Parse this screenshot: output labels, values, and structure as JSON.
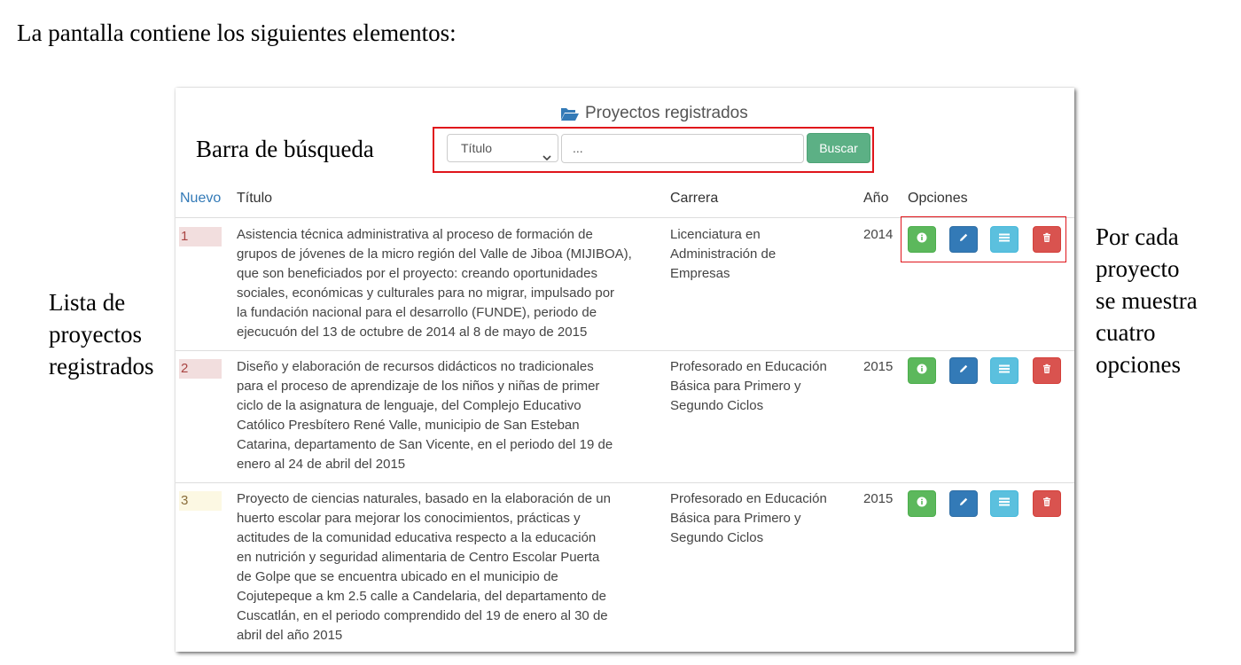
{
  "intro_text": "La pantalla contiene los siguientes elementos:",
  "panel": {
    "title": "Proyectos registrados",
    "title_icon": "folder-open-icon"
  },
  "search": {
    "select_value": "Título",
    "input_placeholder": "...",
    "button_label": "Buscar"
  },
  "table": {
    "headers": {
      "nuevo": "Nuevo",
      "titulo": "Título",
      "carrera": "Carrera",
      "anio": "Año",
      "opciones": "Opciones"
    },
    "rows": [
      {
        "num": "1",
        "title_lines": [
          "Asistencia técnica administrativa al proceso de formación de",
          "grupos de jóvenes de la micro región del Valle de Jiboa (MIJIBOA),",
          "que son beneficiados por el proyecto: creando oportunidades",
          "sociales, económicas y culturales para no migrar, impulsado por",
          "la fundación nacional para el desarrollo (FUNDE), periodo de",
          "ejecucuón del 13 de octubre de 2014 al 8 de mayo de 2015"
        ],
        "carrera_lines": [
          "Licenciatura en",
          "Administración de",
          "Empresas"
        ],
        "anio": "2014"
      },
      {
        "num": "2",
        "title_lines": [
          "Diseño y elaboración de recursos didácticos no tradicionales",
          "para el proceso de aprendizaje de los niños y niñas de primer",
          "ciclo de la asignatura de lenguaje, del Complejo Educativo",
          "Católico Presbítero René Valle, municipio de San Esteban",
          "Catarina, departamento de San Vicente, en el periodo del 19 de",
          "enero al 24 de abril del 2015"
        ],
        "carrera_lines": [
          "Profesorado en Educación",
          "Básica para Primero y",
          "Segundo Ciclos"
        ],
        "anio": "2015"
      },
      {
        "num": "3",
        "title_lines": [
          "Proyecto de ciencias naturales, basado en la elaboración de un",
          "huerto escolar para mejorar los conocimientos, prácticas y",
          "actitudes de la comunidad educativa respecto a la educación",
          "en nutrición y seguridad alimentaria de Centro Escolar Puerta",
          "de Golpe que se encuentra ubicado en el municipio de",
          "Cojutepeque a km 2.5 calle a Candelaria, del departamento de",
          "Cuscatlán, en el periodo comprendido del 19 de enero al 30 de",
          "abril del año 2015"
        ],
        "carrera_lines": [
          "Profesorado en Educación",
          "Básica para Primero y",
          "Segundo Ciclos"
        ],
        "anio": "2015"
      }
    ],
    "option_icons": [
      "info-icon",
      "pencil-icon",
      "list-icon",
      "trash-icon"
    ]
  },
  "annotations": {
    "search_bar": "Barra de búsqueda",
    "list_lines": [
      "Lista de",
      "proyectos",
      "registrados"
    ],
    "options_lines": [
      "Por cada",
      "proyecto",
      "se muestra",
      "cuatro",
      "opciones"
    ]
  },
  "colors": {
    "highlight_border": "#e0151b",
    "info": "#5cb85c",
    "edit": "#337ab7",
    "list": "#5bc0de",
    "delete": "#d9534f",
    "search_button": "#5cb085",
    "link": "#337ab7"
  }
}
